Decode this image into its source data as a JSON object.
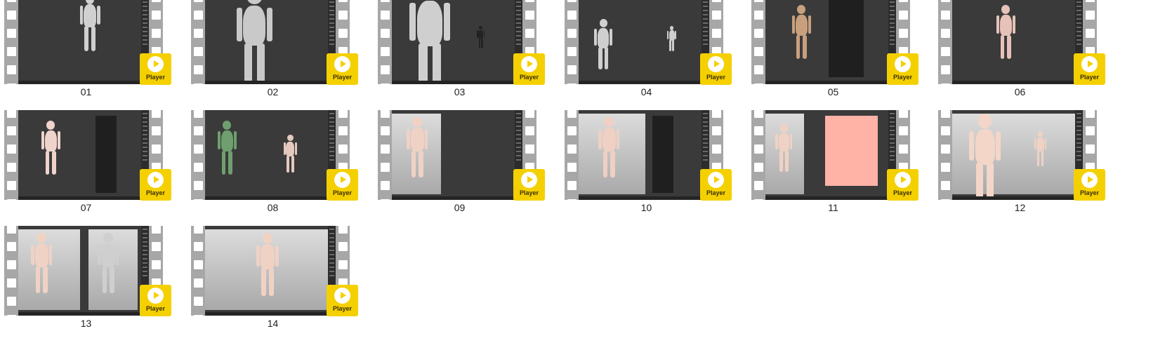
{
  "player_label": "Player",
  "colors": {
    "player": "#f5d000",
    "film": "#a7a7a7",
    "screen": "#3a3a3a"
  },
  "thumbnails": [
    {
      "caption": "01"
    },
    {
      "caption": "02"
    },
    {
      "caption": "03"
    },
    {
      "caption": "04"
    },
    {
      "caption": "05"
    },
    {
      "caption": "06"
    },
    {
      "caption": "07"
    },
    {
      "caption": "08"
    },
    {
      "caption": "09"
    },
    {
      "caption": "10"
    },
    {
      "caption": "11"
    },
    {
      "caption": "12"
    },
    {
      "caption": "13"
    },
    {
      "caption": "14"
    }
  ]
}
